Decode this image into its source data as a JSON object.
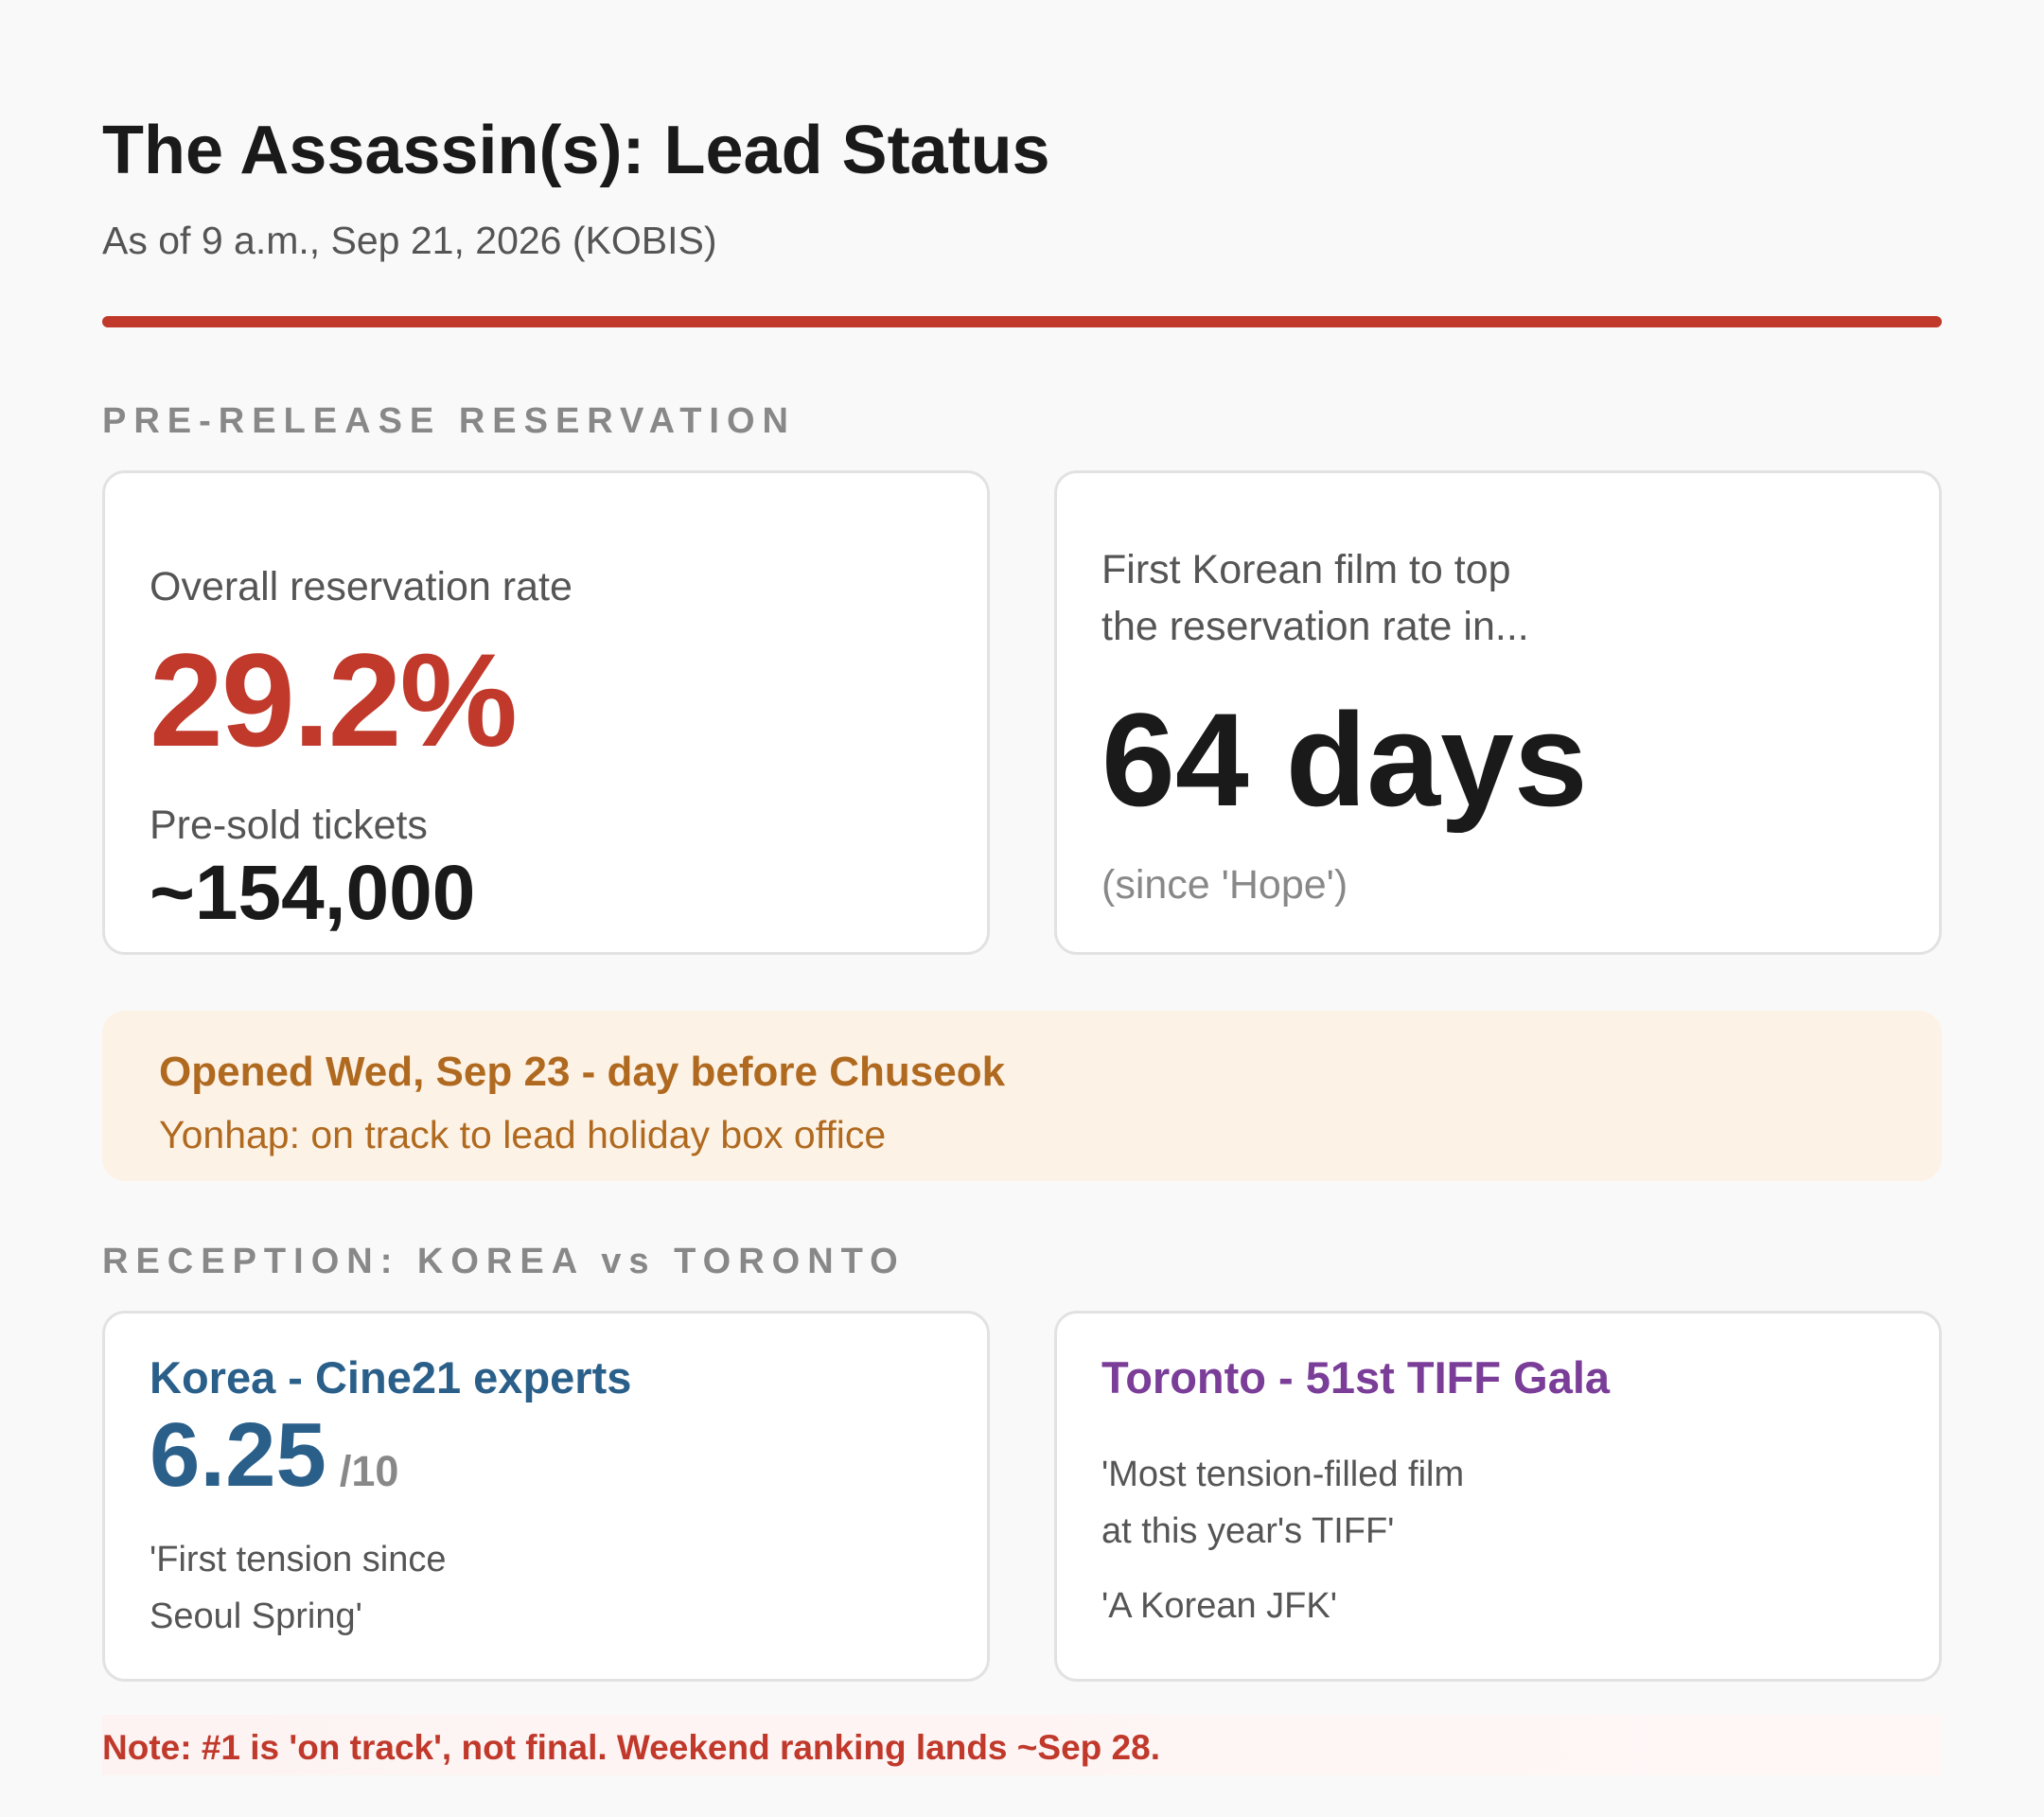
{
  "header": {
    "title": "The Assassin(s): Lead Status",
    "subtitle": "As of 9 a.m., Sep 21, 2026 (KOBIS)",
    "accent_color": "#c0392b"
  },
  "reservation": {
    "section_label": "PRE-RELEASE RESERVATION",
    "rate_label": "Overall reservation rate",
    "rate_value": "29.2%",
    "tickets_label": "Pre-sold tickets",
    "tickets_value": "~154,000",
    "first_label_line1": "First Korean film to top",
    "first_label_line2": "the reservation rate in...",
    "first_value": "64 days",
    "first_note": "(since 'Hope')"
  },
  "banner": {
    "headline": "Opened Wed, Sep 23 - day before Chuseok",
    "sub": "Yonhap: on track to lead holiday box office"
  },
  "reception": {
    "section_label": "RECEPTION: KOREA vs TORONTO",
    "korea": {
      "title": "Korea - Cine21 experts",
      "score": "6.25",
      "score_den": "/10",
      "quote_line1": "'First tension since",
      "quote_line2": "Seoul Spring'"
    },
    "toronto": {
      "title": "Toronto - 51st TIFF Gala",
      "quote1_line1": "'Most tension-filled film",
      "quote1_line2": "at this year's TIFF'",
      "quote2": "'A Korean JFK'"
    }
  },
  "note": "Note: #1 is 'on track', not final. Weekend ranking lands ~Sep 28."
}
